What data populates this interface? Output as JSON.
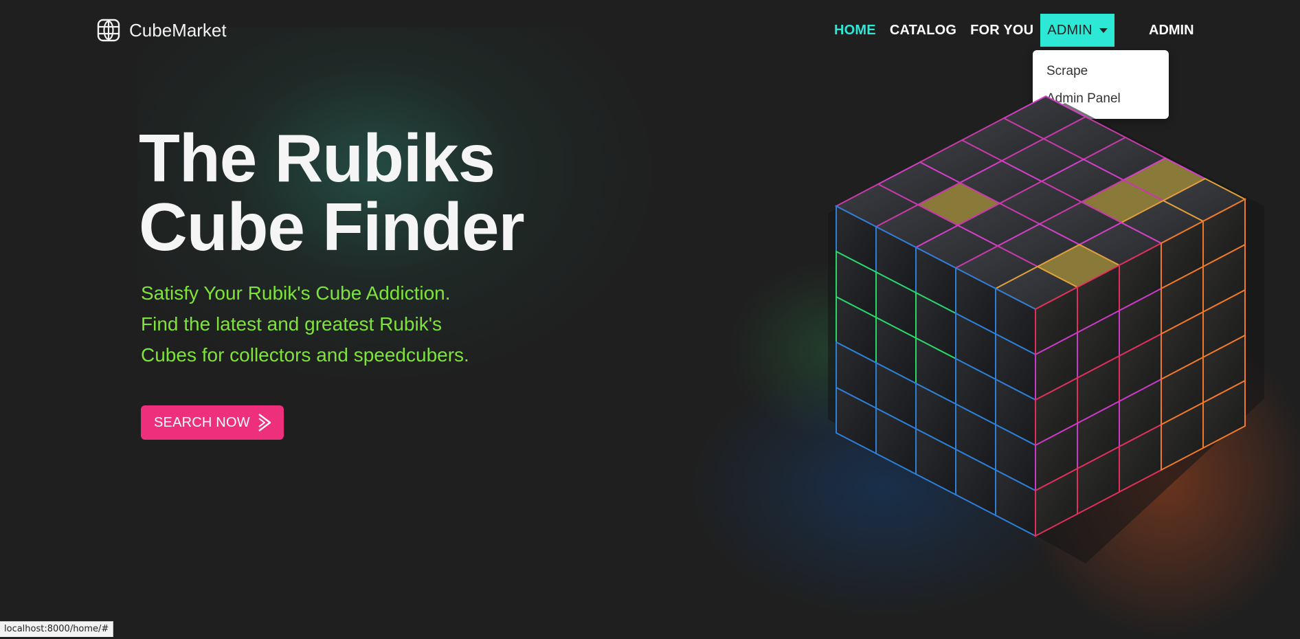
{
  "brand": {
    "name": "CubeMarket",
    "icon": "globe-icon"
  },
  "nav": {
    "links": [
      "HOME",
      "CATALOG",
      "FOR YOU"
    ],
    "active": "HOME",
    "dropdown_label": "ADMIN",
    "user_label": "ADMIN"
  },
  "dropdown": {
    "items": [
      "Scrape",
      "Admin Panel"
    ]
  },
  "hero": {
    "title_lines": [
      "The Rubiks",
      "Cube Finder"
    ],
    "subtitle_lines": [
      "Satisfy Your Rubik's Cube Addiction.",
      "Find the latest and greatest Rubik's",
      "Cubes for collectors and speedcubers."
    ],
    "cta_label": "SEARCH NOW",
    "cta_icon": "chevron-right-icon"
  },
  "status_bar": {
    "url": "localhost:8000/home/#"
  },
  "colors": {
    "background": "#1f1f1f",
    "accent": "#2ee8d6",
    "subtitle": "#7ee33a",
    "cta": "#ee2f7b"
  }
}
